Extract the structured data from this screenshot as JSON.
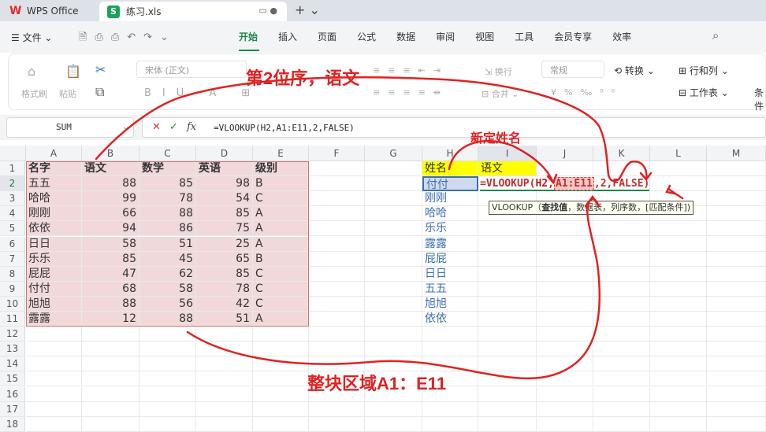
{
  "app": {
    "home_tab": "WPS Office",
    "file_tab": "练习.xls"
  },
  "menu": {
    "file_label": "文件",
    "tabs": [
      "开始",
      "插入",
      "页面",
      "公式",
      "数据",
      "审阅",
      "视图",
      "工具",
      "会员专享",
      "效率"
    ],
    "active_tab": "开始"
  },
  "ribbon": {
    "format_painter": "格式刷",
    "paste": "粘贴",
    "font_name": "宋体 (正文)",
    "wrap": "换行",
    "merge": "合并",
    "number_format": "常规",
    "convert": "转换",
    "rows_cols": "行和列",
    "worksheet": "工作表",
    "cond": "条件"
  },
  "formula_bar": {
    "name_box": "SUM",
    "formula": "=VLOOKUP(H2,A1:E11,2,FALSE)"
  },
  "columns": [
    "A",
    "B",
    "C",
    "D",
    "E",
    "F",
    "G",
    "H",
    "I",
    "J",
    "K",
    "L",
    "M"
  ],
  "rows": [
    "1",
    "2",
    "3",
    "4",
    "5",
    "6",
    "7",
    "8",
    "9",
    "10",
    "11",
    "12",
    "13",
    "14",
    "15",
    "16",
    "17",
    "18"
  ],
  "table": {
    "headers": [
      "名字",
      "语文",
      "数学",
      "英语",
      "级别"
    ],
    "data": [
      [
        "五五",
        "88",
        "85",
        "98",
        "B"
      ],
      [
        "哈哈",
        "99",
        "78",
        "54",
        "C"
      ],
      [
        "刚刚",
        "66",
        "88",
        "85",
        "A"
      ],
      [
        "依依",
        "94",
        "86",
        "75",
        "A"
      ],
      [
        "日日",
        "58",
        "51",
        "25",
        "A"
      ],
      [
        "乐乐",
        "85",
        "45",
        "65",
        "B"
      ],
      [
        "屁屁",
        "47",
        "62",
        "85",
        "C"
      ],
      [
        "付付",
        "68",
        "58",
        "78",
        "C"
      ],
      [
        "旭旭",
        "88",
        "56",
        "42",
        "C"
      ],
      [
        "露露",
        "12",
        "88",
        "51",
        "A"
      ]
    ]
  },
  "lookup": {
    "h_header": "姓名",
    "i_header": "语文",
    "names": [
      "付付",
      "刚刚",
      "哈哈",
      "乐乐",
      "露露",
      "屁屁",
      "日日",
      "五五",
      "旭旭",
      "依依"
    ],
    "formula_prefix": "=VLOOKUP(",
    "arg1": "H2",
    "sep1": ",",
    "arg2": "A1:E11",
    "rest": ",2,FALSE)"
  },
  "tooltip": {
    "fn": "VLOOKUP（",
    "arg_bold": "查找值",
    "rest": "，数据表，列序数，[匹配条件])"
  },
  "annotations": {
    "top": "第2位序，语文",
    "name": "新定姓名",
    "range": "整块区域A1：E11"
  },
  "colors": {
    "accent": "#1a8a4a",
    "annotation": "#e02222",
    "table_fill": "#f1d9da",
    "header_highlight": "#ffff00"
  }
}
